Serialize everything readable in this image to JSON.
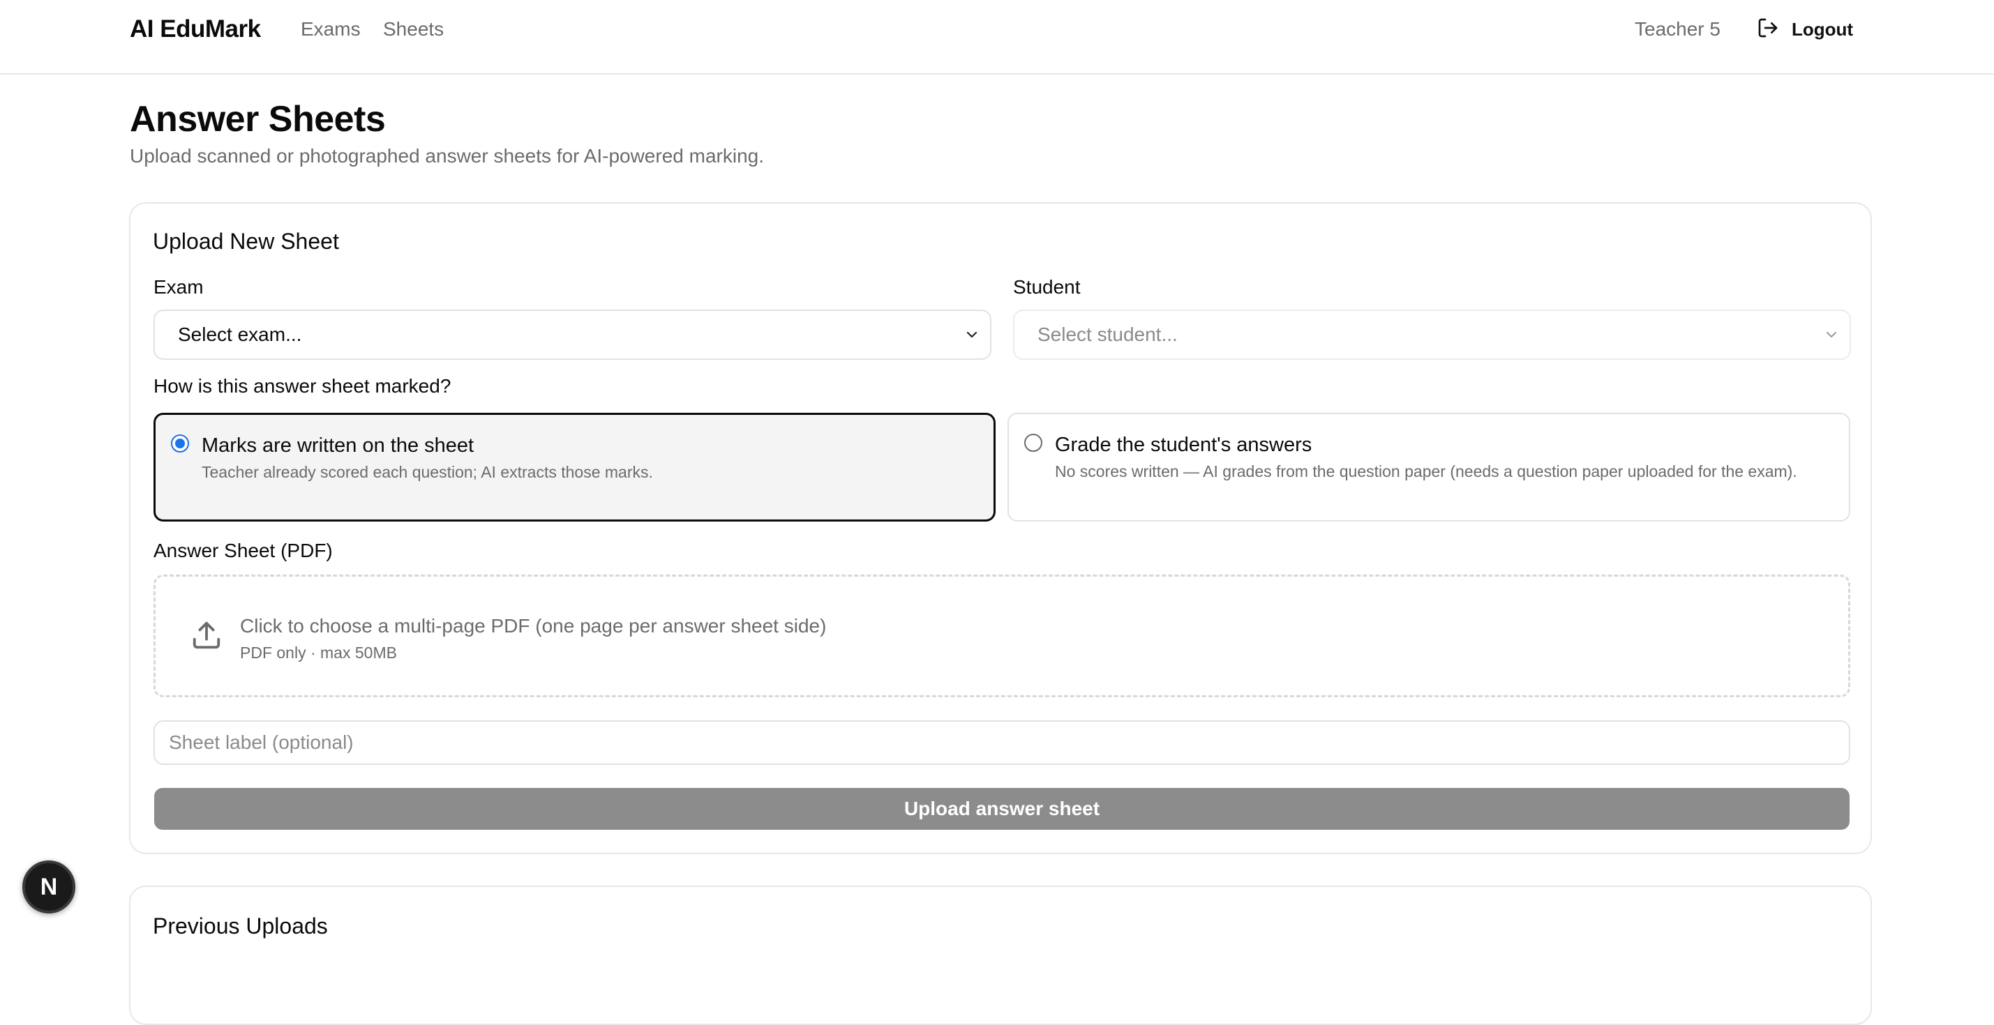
{
  "header": {
    "brand": "AI EduMark",
    "nav": [
      "Exams",
      "Sheets"
    ],
    "user": "Teacher 5",
    "logout_label": "Logout"
  },
  "page": {
    "title": "Answer Sheets",
    "subtitle": "Upload scanned or photographed answer sheets for AI-powered marking."
  },
  "upload_card": {
    "title": "Upload New Sheet",
    "exam": {
      "label": "Exam",
      "value": "Select exam..."
    },
    "student": {
      "label": "Student",
      "value": "Select student..."
    },
    "marking_question": "How is this answer sheet marked?",
    "marking_options": [
      {
        "title": "Marks are written on the sheet",
        "description": "Teacher already scored each question; AI extracts those marks.",
        "selected": true
      },
      {
        "title": "Grade the student's answers",
        "description": "No scores written — AI grades from the question paper (needs a question paper uploaded for the exam).",
        "selected": false
      }
    ],
    "file": {
      "label": "Answer Sheet (PDF)",
      "prompt": "Click to choose a multi-page PDF (one page per answer sheet side)",
      "hint": "PDF only · max 50MB"
    },
    "sheet_label_placeholder": "Sheet label (optional)",
    "submit_label": "Upload answer sheet"
  },
  "previous_uploads": {
    "title": "Previous Uploads"
  },
  "dev_badge": "N",
  "colors": {
    "radio_accent": "#1a73e8",
    "disabled_button": "#8c8c8c",
    "selected_card_bg": "#f4f4f4"
  }
}
